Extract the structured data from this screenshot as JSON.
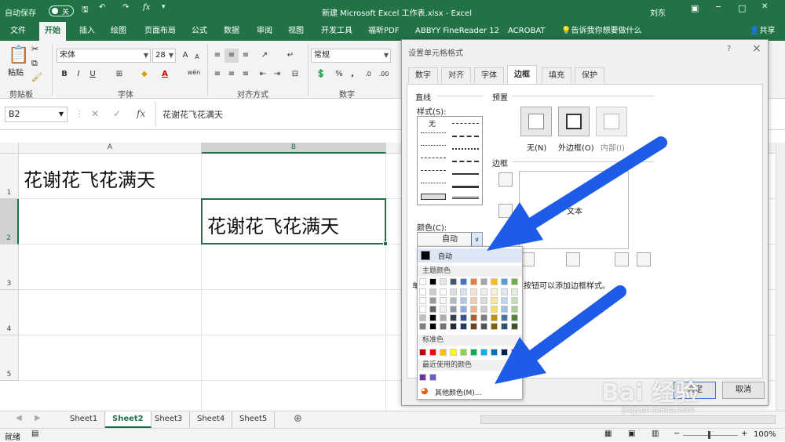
{
  "titlebar": {
    "autosave": "自动保存",
    "autosave_state": "关",
    "title": "新建 Microsoft Excel 工作表.xlsx - Excel",
    "user": "刘东"
  },
  "ribbon_tabs": [
    "文件",
    "开始",
    "插入",
    "绘图",
    "页面布局",
    "公式",
    "数据",
    "审阅",
    "视图",
    "开发工具",
    "福昕PDF",
    "ABBYY FineReader 12",
    "ACROBAT",
    "告诉我你想要做什么",
    "共享"
  ],
  "ribbon": {
    "paste": "粘贴",
    "clipboard": "剪贴板",
    "font_name": "宋体",
    "font_size": "28",
    "font_group": "字体",
    "align_group": "对齐方式",
    "number_format": "常规",
    "number_group": "数字",
    "bold": "B",
    "italic": "I",
    "underline": "U",
    "wen": "wén",
    "percent": "%",
    "comma": ","
  },
  "formula_bar": {
    "namebox": "B2",
    "fx": "fx",
    "content": "花谢花飞花满天"
  },
  "grid": {
    "col_a": "A",
    "col_b": "B",
    "rows": [
      "1",
      "2",
      "3",
      "4",
      "5"
    ],
    "a1": "花谢花飞花满天",
    "b2": "花谢花飞花满天"
  },
  "sheets": [
    "Sheet1",
    "Sheet2",
    "Sheet3",
    "Sheet4",
    "Sheet5"
  ],
  "active_sheet": "Sheet2",
  "status": {
    "left": "就绪",
    "zoom": "100%"
  },
  "dialog": {
    "title": "设置单元格格式",
    "help": "?",
    "close": "×",
    "tabs": [
      "数字",
      "对齐",
      "字体",
      "边框",
      "填充",
      "保护"
    ],
    "line_label": "直线",
    "style_label": "样式(S):",
    "style_none": "无",
    "color_label": "颜色(C):",
    "color_value": "自动",
    "preset_label": "预置",
    "presets": [
      "无(N)",
      "外边框(O)",
      "内部(I)"
    ],
    "border_label": "边框",
    "preview_text": "文本",
    "hint_text": "单击预置选项、预览草图及上面的按钮可以添加边框样式。",
    "hint_visible_prefix": "单",
    "hint_visible": "按钮可以添加边框样式。",
    "ok": "确定",
    "cancel": "取消"
  },
  "colorpop": {
    "auto": "自动",
    "theme": "主题颜色",
    "standard": "标准色",
    "recent": "最近使用的颜色",
    "more": "其他颜色(M)...",
    "theme_colors": [
      "#ffffff",
      "#000000",
      "#e7e6e6",
      "#44546a",
      "#4472c4",
      "#ed7d31",
      "#a5a5a5",
      "#ffc000",
      "#5b9bd5",
      "#70ad47"
    ],
    "standard_colors": [
      "#c00000",
      "#ff0000",
      "#ffc000",
      "#ffff00",
      "#92d050",
      "#00b050",
      "#00b0f0",
      "#0070c0",
      "#002060",
      "#7030a0"
    ],
    "recent_colors": [
      "#7030a0",
      "#6a5acd"
    ]
  },
  "watermark": {
    "brand": "Bai  经验",
    "url": "jingyan.baidu.com"
  },
  "colors": {
    "excel_green": "#217346",
    "arrow_blue": "#1e5be6"
  }
}
